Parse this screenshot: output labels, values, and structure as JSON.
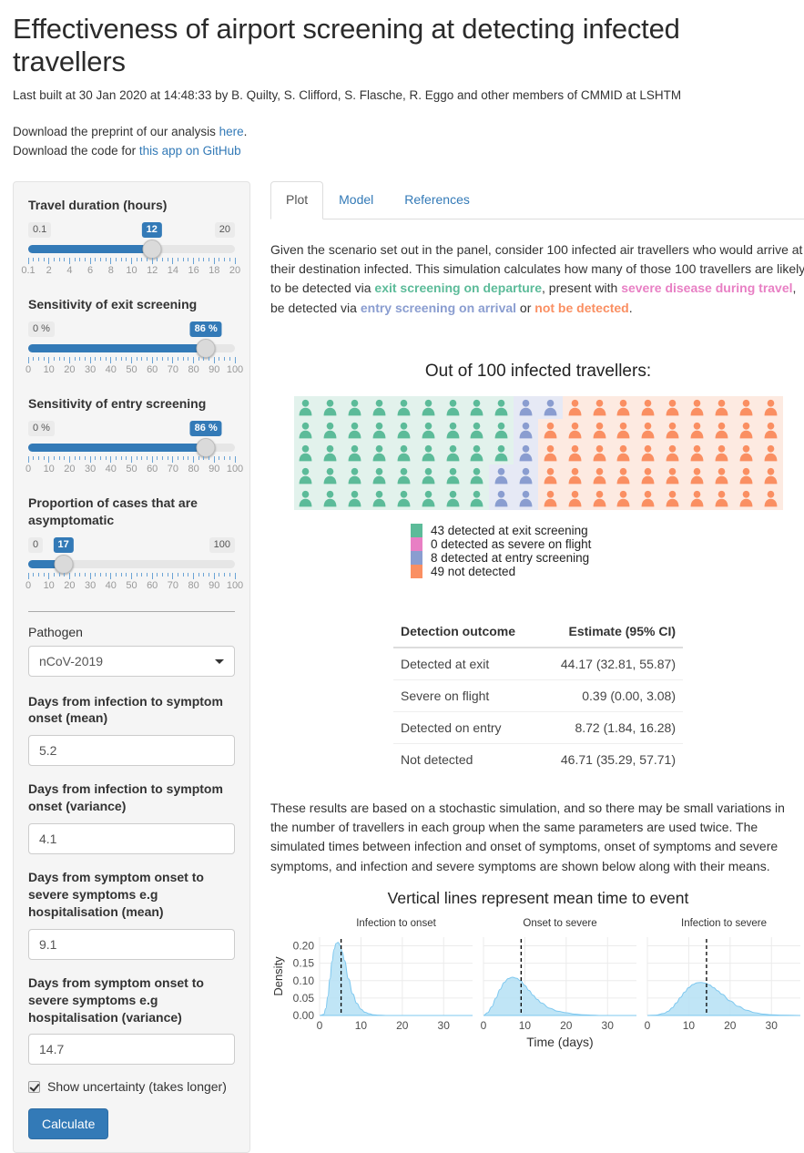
{
  "header": {
    "title": "Effectiveness of airport screening at detecting infected travellers",
    "built": "Last built at 30 Jan 2020 at 14:48:33 by B. Quilty, S. Clifford, S. Flasche, R. Eggo and other members of CMMID at LSHTM",
    "download_preprint_prefix": "Download the preprint of our analysis ",
    "download_preprint_link": "here",
    "download_preprint_suffix": ".",
    "download_code_prefix": "Download the code for ",
    "download_code_link_a": "this app",
    "download_code_mid": " ",
    "download_code_link_b": "on GitHub"
  },
  "sidebar": {
    "sliders": [
      {
        "label": "Travel duration (hours)",
        "min_label": "0.1",
        "max_label": "20",
        "value_label": "12",
        "pct": 59.8,
        "ticks": [
          "0.1",
          "2",
          "4",
          "6",
          "8",
          "10",
          "12",
          "14",
          "16",
          "18",
          "20"
        ]
      },
      {
        "label": "Sensitivity of exit screening",
        "min_label": "0 %",
        "max_label": "",
        "value_label": "86 %",
        "pct": 86,
        "ticks": [
          "0",
          "10",
          "20",
          "30",
          "40",
          "50",
          "60",
          "70",
          "80",
          "90",
          "100"
        ]
      },
      {
        "label": "Sensitivity of entry screening",
        "min_label": "0 %",
        "max_label": "",
        "value_label": "86 %",
        "pct": 86,
        "ticks": [
          "0",
          "10",
          "20",
          "30",
          "40",
          "50",
          "60",
          "70",
          "80",
          "90",
          "100"
        ]
      },
      {
        "label": "Proportion of cases that are asymptomatic",
        "min_label": "0",
        "max_label": "100",
        "value_label": "17",
        "pct": 17,
        "ticks": [
          "0",
          "10",
          "20",
          "30",
          "40",
          "50",
          "60",
          "70",
          "80",
          "90",
          "100"
        ]
      }
    ],
    "pathogen_label": "Pathogen",
    "pathogen_value": "nCoV-2019",
    "fields": [
      {
        "label": "Days from infection to symptom onset (mean)",
        "value": "5.2"
      },
      {
        "label": "Days from infection to symptom onset (variance)",
        "value": "4.1"
      },
      {
        "label": "Days from symptom onset to severe symptoms e.g hospitalisation (mean)",
        "value": "9.1"
      },
      {
        "label": "Days from symptom onset to severe symptoms e.g hospitalisation (variance)",
        "value": "14.7"
      }
    ],
    "checkbox_label": "Show uncertainty (takes longer)",
    "checkbox_checked": true,
    "calculate_label": "Calculate"
  },
  "tabs": [
    {
      "label": "Plot",
      "active": true
    },
    {
      "label": "Model",
      "active": false
    },
    {
      "label": "References",
      "active": false
    }
  ],
  "intro": {
    "t1": "Given the scenario set out in the panel, consider 100 infected air travellers who would arrive at their destination infected. This simulation calculates how many of those 100 travellers are likely to be detected via ",
    "h1": "exit screening on departure",
    "t2": ", present with ",
    "h2": "severe disease during travel",
    "t3": ", be detected via ",
    "h3": "entry screening on arrival",
    "t4": " or ",
    "h4": "not be detected",
    "t5": "."
  },
  "waffle": {
    "title": "Out of 100 infected travellers:",
    "rows": [
      [
        "g",
        "g",
        "g",
        "g",
        "g",
        "g",
        "g",
        "g",
        "g",
        "p",
        "p",
        "o",
        "o",
        "o",
        "o",
        "o",
        "o",
        "o",
        "o",
        "o"
      ],
      [
        "g",
        "g",
        "g",
        "g",
        "g",
        "g",
        "g",
        "g",
        "g",
        "p",
        "o",
        "o",
        "o",
        "o",
        "o",
        "o",
        "o",
        "o",
        "o",
        "o"
      ],
      [
        "g",
        "g",
        "g",
        "g",
        "g",
        "g",
        "g",
        "g",
        "g",
        "p",
        "o",
        "o",
        "o",
        "o",
        "o",
        "o",
        "o",
        "o",
        "o",
        "o"
      ],
      [
        "g",
        "g",
        "g",
        "g",
        "g",
        "g",
        "g",
        "g",
        "p",
        "p",
        "o",
        "o",
        "o",
        "o",
        "o",
        "o",
        "o",
        "o",
        "o",
        "o"
      ],
      [
        "g",
        "g",
        "g",
        "g",
        "g",
        "g",
        "g",
        "g",
        "p",
        "p",
        "o",
        "o",
        "o",
        "o",
        "o",
        "o",
        "o",
        "o",
        "o",
        "o"
      ]
    ],
    "legend": [
      {
        "color_key": "g",
        "text": "43 detected at exit screening"
      },
      {
        "color_key": "s",
        "text": "0 detected as severe on flight"
      },
      {
        "color_key": "p",
        "text": "8 detected at entry screening"
      },
      {
        "color_key": "o",
        "text": "49 not detected"
      }
    ]
  },
  "colors": {
    "g": "#5cbb99",
    "s": "#e87fc4",
    "p": "#8a9dd0",
    "o": "#fa8f62",
    "g_bg": "#e2f2ec",
    "p_bg": "#e6e9f5",
    "o_bg": "#fdeae1",
    "accent": "#337ab7",
    "density_fill": "#b5e0f5",
    "density_line": "#7ec8ef"
  },
  "table": {
    "headers": [
      "Detection outcome",
      "Estimate (95% CI)"
    ],
    "rows": [
      [
        "Detected at exit",
        "44.17 (32.81, 55.87)"
      ],
      [
        "Severe on flight",
        "0.39 (0.00, 3.08)"
      ],
      [
        "Detected on entry",
        "8.72 (1.84, 16.28)"
      ],
      [
        "Not detected",
        "46.71 (35.29, 57.71)"
      ]
    ]
  },
  "note": "These results are based on a stochastic simulation, and so there may be small variations in the number of travellers in each group when the same parameters are used twice. The simulated times between infection and onset of symptoms, onset of symptoms and severe symptoms, and infection and severe symptoms are shown below along with their means.",
  "chart_data": {
    "type": "area",
    "title": "Vertical lines represent mean time to event",
    "xlabel": "Time (days)",
    "ylabel": "Density",
    "ylim": [
      0,
      0.225
    ],
    "xlim": [
      0,
      37
    ],
    "yticks": [
      0.0,
      0.05,
      0.1,
      0.15,
      0.2
    ],
    "ytick_labels": [
      "0.00",
      "0.05",
      "0.10",
      "0.15",
      "0.20"
    ],
    "xticks": [
      0,
      10,
      20,
      30
    ],
    "xtick_labels": [
      "0",
      "10",
      "20",
      "30"
    ],
    "grid": true,
    "panels": [
      {
        "facet": "Infection to onset",
        "mean_line": 5.2,
        "peak_x": 4.6,
        "peak_y": 0.21,
        "x": [
          0,
          1,
          1.5,
          2,
          2.5,
          3,
          3.5,
          4,
          4.5,
          5,
          5.5,
          6,
          7,
          8,
          9,
          10,
          11,
          12,
          13,
          14,
          16,
          20,
          25,
          30,
          37
        ],
        "y": [
          0,
          0.003,
          0.02,
          0.055,
          0.105,
          0.155,
          0.19,
          0.207,
          0.21,
          0.2,
          0.182,
          0.158,
          0.105,
          0.062,
          0.035,
          0.018,
          0.009,
          0.005,
          0.002,
          0.001,
          0,
          0,
          0,
          0,
          0
        ]
      },
      {
        "facet": "Onset to severe",
        "mean_line": 9.1,
        "peak_x": 7.2,
        "peak_y": 0.11,
        "x": [
          0,
          1,
          2,
          3,
          4,
          5,
          6,
          7,
          8,
          9,
          10,
          11,
          12,
          13,
          14,
          16,
          18,
          20,
          22,
          24,
          26,
          28,
          30,
          37
        ],
        "y": [
          0,
          0.008,
          0.025,
          0.05,
          0.075,
          0.095,
          0.106,
          0.11,
          0.107,
          0.099,
          0.086,
          0.072,
          0.058,
          0.046,
          0.036,
          0.021,
          0.012,
          0.008,
          0.004,
          0.002,
          0.001,
          0,
          0,
          0
        ]
      },
      {
        "facet": "Infection to severe",
        "mean_line": 14.3,
        "peak_x": 13.0,
        "peak_y": 0.095,
        "x": [
          0,
          2,
          4,
          5,
          6,
          7,
          8,
          9,
          10,
          11,
          12,
          13,
          14,
          15,
          16,
          17,
          18,
          20,
          22,
          24,
          26,
          28,
          30,
          32,
          37
        ],
        "y": [
          0,
          0.001,
          0.006,
          0.012,
          0.022,
          0.036,
          0.052,
          0.067,
          0.08,
          0.089,
          0.094,
          0.095,
          0.093,
          0.088,
          0.08,
          0.071,
          0.061,
          0.042,
          0.026,
          0.015,
          0.008,
          0.004,
          0.002,
          0.001,
          0
        ]
      }
    ]
  }
}
